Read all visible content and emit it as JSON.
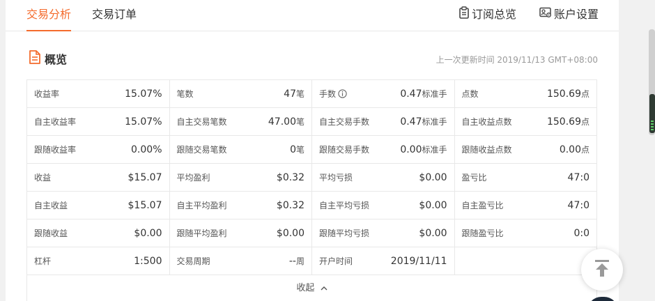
{
  "nav": {
    "tabs": [
      {
        "label": "交易分析",
        "active": true
      },
      {
        "label": "交易订单",
        "active": false
      }
    ],
    "subscribe_label": "订阅总览",
    "settings_label": "账户设置"
  },
  "overview": {
    "title": "概览",
    "last_update": "上一次更新时间 2019/11/13 GMT+08:00"
  },
  "stats": {
    "rows": [
      [
        {
          "label": "收益率",
          "value": "15.07%",
          "unit": ""
        },
        {
          "label": "笔数",
          "value": "47",
          "unit": "笔"
        },
        {
          "label": "手数",
          "value": "0.47",
          "unit": "标准手",
          "info": true
        },
        {
          "label": "点数",
          "value": "150.69",
          "unit": "点"
        }
      ],
      [
        {
          "label": "自主收益率",
          "value": "15.07%",
          "unit": ""
        },
        {
          "label": "自主交易笔数",
          "value": "47.00",
          "unit": "笔"
        },
        {
          "label": "自主交易手数",
          "value": "0.47",
          "unit": "标准手"
        },
        {
          "label": "自主收益点数",
          "value": "150.69",
          "unit": "点"
        }
      ],
      [
        {
          "label": "跟随收益率",
          "value": "0.00%",
          "unit": ""
        },
        {
          "label": "跟随交易笔数",
          "value": "0",
          "unit": "笔"
        },
        {
          "label": "跟随交易手数",
          "value": "0.00",
          "unit": "标准手"
        },
        {
          "label": "跟随收益点数",
          "value": "0.00",
          "unit": "点"
        }
      ],
      [
        {
          "label": "收益",
          "value": "$15.07",
          "unit": ""
        },
        {
          "label": "平均盈利",
          "value": "$0.32",
          "unit": ""
        },
        {
          "label": "平均亏损",
          "value": "$0.00",
          "unit": ""
        },
        {
          "label": "盈亏比",
          "value": "47:0",
          "unit": ""
        }
      ],
      [
        {
          "label": "自主收益",
          "value": "$15.07",
          "unit": ""
        },
        {
          "label": "自主平均盈利",
          "value": "$0.32",
          "unit": ""
        },
        {
          "label": "自主平均亏损",
          "value": "$0.00",
          "unit": ""
        },
        {
          "label": "自主盈亏比",
          "value": "47:0",
          "unit": ""
        }
      ],
      [
        {
          "label": "跟随收益",
          "value": "$0.00",
          "unit": ""
        },
        {
          "label": "跟随平均盈利",
          "value": "$0.00",
          "unit": ""
        },
        {
          "label": "跟随平均亏损",
          "value": "$0.00",
          "unit": ""
        },
        {
          "label": "跟随盈亏比",
          "value": "0:0",
          "unit": ""
        }
      ],
      [
        {
          "label": "杠杆",
          "value": "1:500",
          "unit": ""
        },
        {
          "label": "交易周期",
          "value": "--",
          "unit": "周"
        },
        {
          "label": "开户时间",
          "value": "2019/11/11",
          "unit": ""
        },
        {
          "label": "",
          "value": "",
          "unit": ""
        }
      ]
    ],
    "collapse_label": "收起"
  },
  "colors": {
    "accent": "#f46b2c",
    "border": "#e8e8e8"
  },
  "icons": {
    "overview": "document-icon",
    "subscribe": "clipboard-icon",
    "settings": "account-settings-icon",
    "back_to_top": "arrow-up-to-line-icon"
  }
}
